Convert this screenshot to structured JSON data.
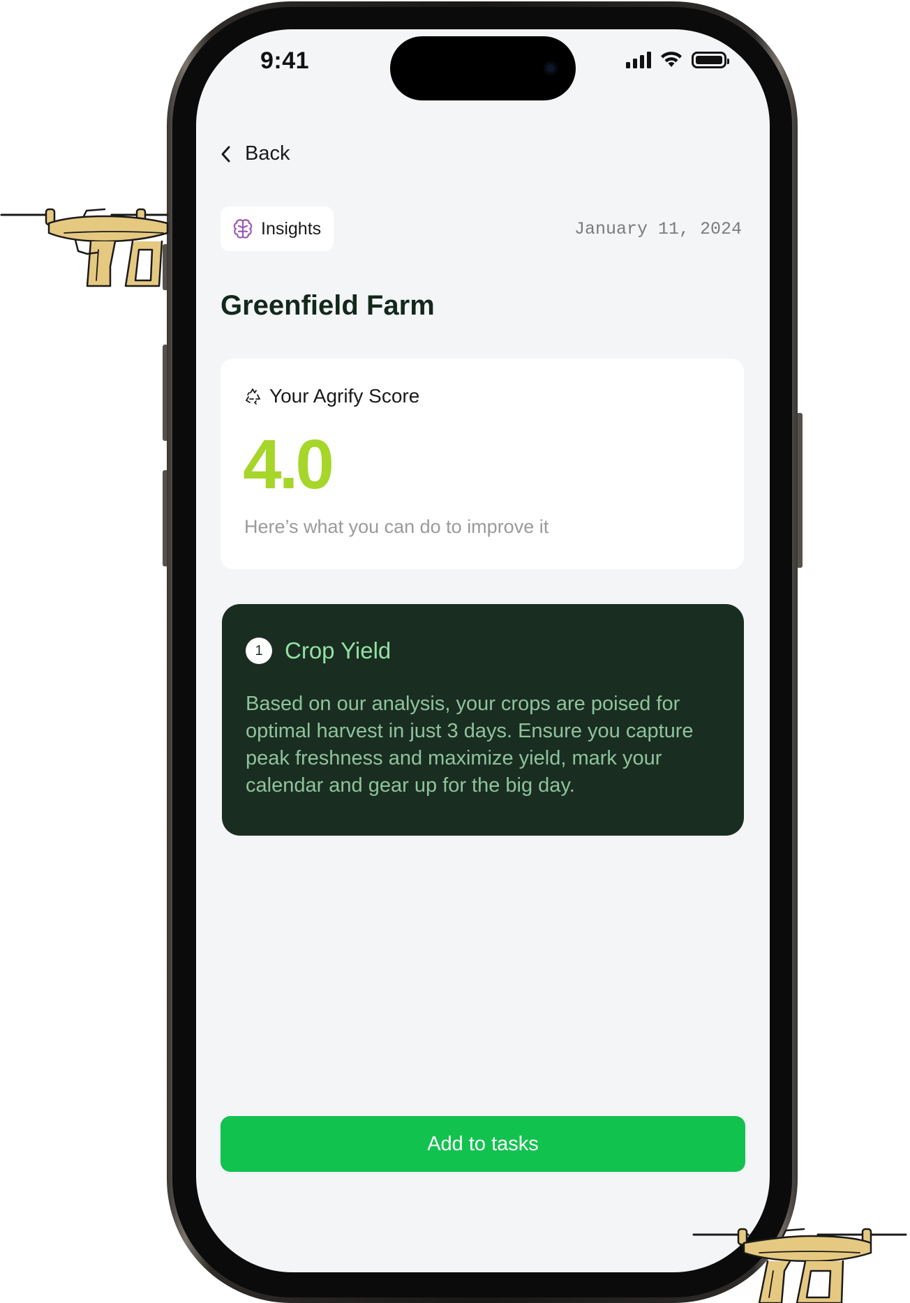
{
  "status_bar": {
    "time": "9:41"
  },
  "nav": {
    "back_label": "Back"
  },
  "header": {
    "chip_label": "Insights",
    "date": "January 11, 2024",
    "farm_name": "Greenfield Farm"
  },
  "score_card": {
    "title": "Your Agrify Score",
    "score": "4.0",
    "subtitle": "Here’s what you can do to improve it"
  },
  "insight": {
    "number": "1",
    "title": "Crop Yield",
    "body": "Based on our analysis, your crops are poised for optimal harvest in just 3 days. Ensure you capture peak freshness and maximize yield, mark your calendar and gear up for the big day."
  },
  "cta": {
    "label": "Add to tasks"
  },
  "colors": {
    "accent_green": "#12c24f",
    "score_lime": "#a6d62a",
    "card_dark": "#1a2d21",
    "insight_title": "#93e0a4",
    "chip_icon_purple": "#9b59b6"
  }
}
